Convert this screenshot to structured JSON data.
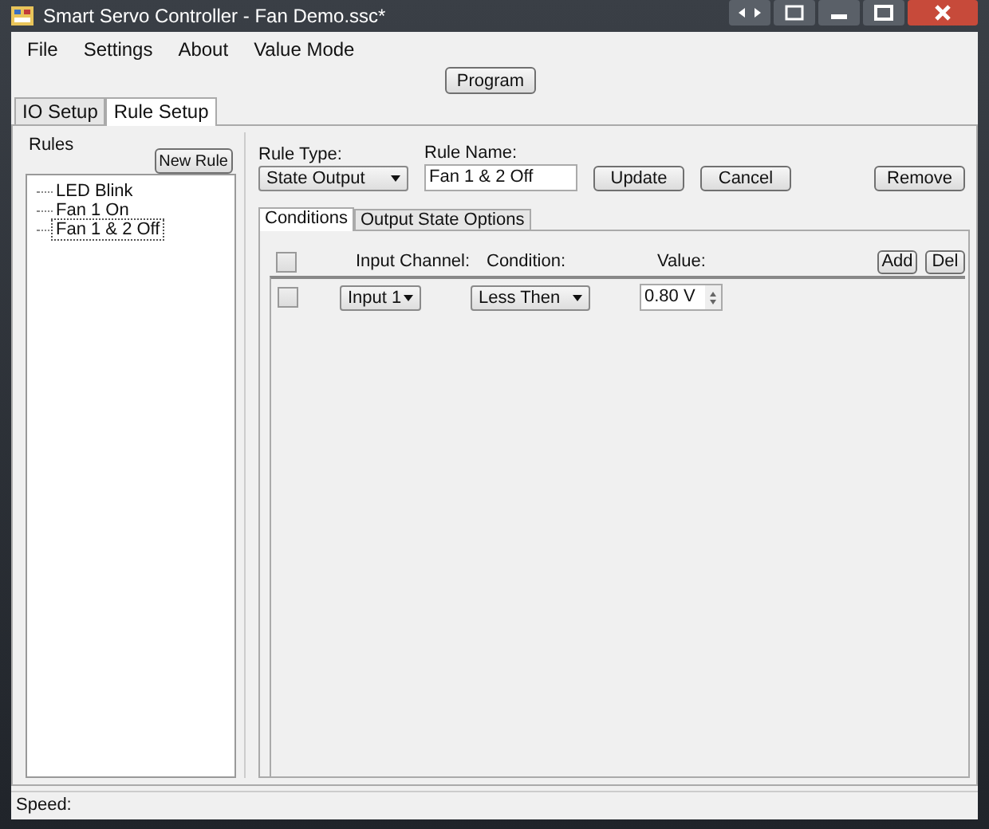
{
  "window": {
    "title": "Smart Servo Controller - Fan Demo.ssc*"
  },
  "menu": [
    "File",
    "Settings",
    "About",
    "Value Mode"
  ],
  "program_button": "Program",
  "tabs": [
    {
      "label": "IO Setup",
      "selected": false
    },
    {
      "label": "Rule Setup",
      "selected": true
    }
  ],
  "rules": {
    "title": "Rules",
    "new_button": "New Rule",
    "items": [
      {
        "label": "LED Blink",
        "selected": false
      },
      {
        "label": "Fan 1 On",
        "selected": false
      },
      {
        "label": "Fan 1 & 2 Off",
        "selected": true
      }
    ]
  },
  "rule_type": {
    "label": "Rule Type:",
    "value": "State Output"
  },
  "rule_name": {
    "label": "Rule Name:",
    "value": "Fan 1 & 2 Off"
  },
  "buttons": [
    "Update",
    "Cancel"
  ],
  "remove_button": "Remove",
  "inner_tabs": [
    {
      "label": "Conditions",
      "selected": true
    },
    {
      "label": "Output State Options",
      "selected": false
    }
  ],
  "conditions": {
    "header": {
      "checked": false,
      "columns": [
        "Input Channel:",
        "Condition:",
        "Value:"
      ]
    },
    "add_button": "Add",
    "del_button": "Del",
    "rows": [
      {
        "checked": false,
        "input": "Input 1",
        "condition": "Less Then",
        "value": "0.80 V"
      }
    ]
  },
  "status_bar": {
    "label": "Speed:"
  }
}
